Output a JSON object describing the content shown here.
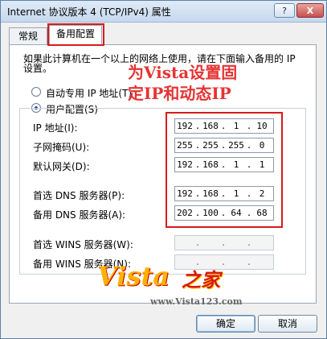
{
  "window": {
    "title": "Internet 协议版本 4 (TCP/IPv4) 属性"
  },
  "titlebar": {
    "help": "?",
    "close": "X"
  },
  "tabs": [
    {
      "label": "常规"
    },
    {
      "label": "备用配置"
    }
  ],
  "description": "如果此计算机在一个以上的网络上使用，请在下面输入备用的 IP 设置。",
  "radios": {
    "auto": "自动专用 IP 地址(T)",
    "user": "用户配置(S)"
  },
  "annotation": {
    "line1": "为Vista设置固",
    "line2": "定IP和动态IP"
  },
  "fields": [
    {
      "label": "IP 地址(I):",
      "value": [
        "192",
        "168",
        "1",
        "10"
      ]
    },
    {
      "label": "子网掩码(U):",
      "value": [
        "255",
        "255",
        "255",
        "0"
      ]
    },
    {
      "label": "默认网关(D):",
      "value": [
        "192",
        "168",
        "1",
        "1"
      ]
    },
    {
      "label": "首选 DNS 服务器(P):",
      "value": [
        "192",
        "168",
        "1",
        "2"
      ]
    },
    {
      "label": "备用 DNS 服务器(A):",
      "value": [
        "202",
        "100",
        "64",
        "68"
      ]
    },
    {
      "label": "首选 WINS 服务器(W):",
      "value": [
        "",
        "",
        "",
        ""
      ]
    },
    {
      "label": "备用 WINS 服务器(N):",
      "value": [
        "",
        "",
        "",
        ""
      ]
    }
  ],
  "buttons": {
    "ok": "确定",
    "cancel": "取消"
  },
  "watermark": {
    "logo": "Vista",
    "suffix": "之家",
    "url": "www.Vista123.com"
  }
}
